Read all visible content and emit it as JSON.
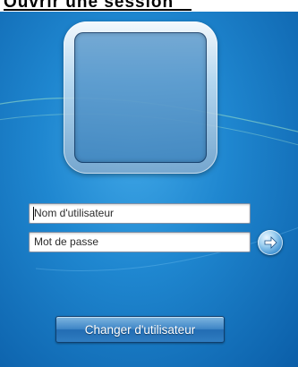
{
  "header": {
    "title_text": "Ouvrir une session"
  },
  "login": {
    "username_placeholder": "Nom d'utilisateur",
    "password_placeholder": "Mot de passe",
    "submit_icon": "arrow-right-icon",
    "switch_user_label": "Changer d'utilisateur"
  },
  "colors": {
    "background": "#1f87d0",
    "button": "#2f7dc1",
    "field": "#ffffff"
  }
}
